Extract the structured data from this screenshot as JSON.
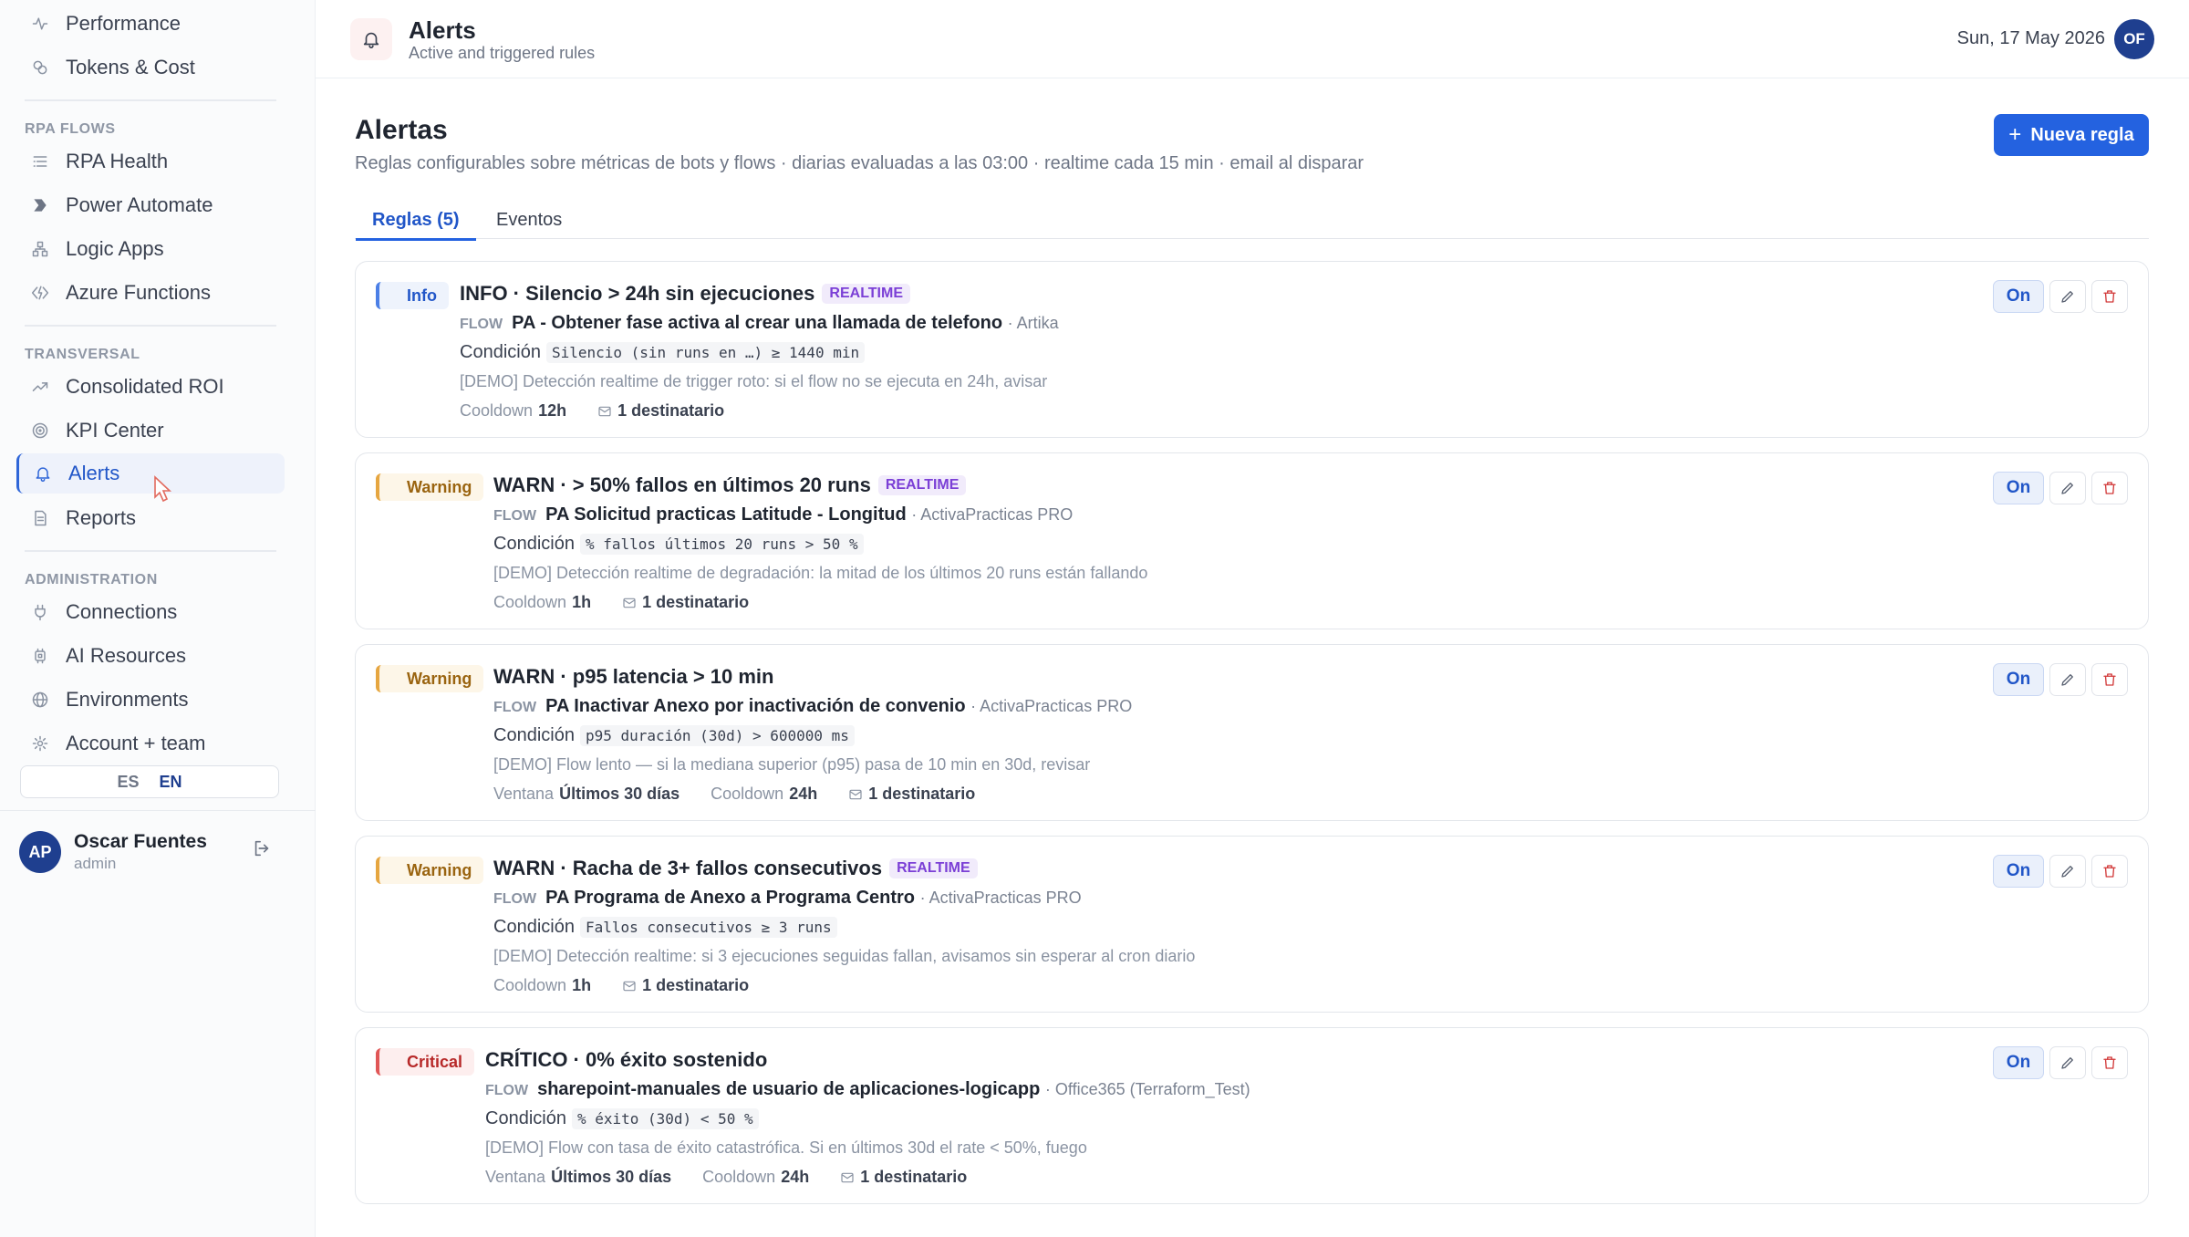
{
  "sidebar": {
    "items_top": [
      {
        "label": "Performance",
        "icon": "activity-icon"
      },
      {
        "label": "Tokens & Cost",
        "icon": "coins-icon"
      }
    ],
    "rpa_title": "RPA FLOWS",
    "rpa_items": [
      {
        "label": "RPA Health",
        "icon": "list-icon"
      },
      {
        "label": "Power Automate",
        "icon": "power-automate-icon"
      },
      {
        "label": "Logic Apps",
        "icon": "hierarchy-icon"
      },
      {
        "label": "Azure Functions",
        "icon": "functions-icon"
      }
    ],
    "transversal_title": "TRANSVERSAL",
    "transversal_items": [
      {
        "label": "Consolidated ROI",
        "icon": "trend-icon"
      },
      {
        "label": "KPI Center",
        "icon": "target-icon"
      },
      {
        "label": "Alerts",
        "icon": "bell-icon"
      },
      {
        "label": "Reports",
        "icon": "document-icon"
      }
    ],
    "admin_title": "ADMINISTRATION",
    "admin_items": [
      {
        "label": "Connections",
        "icon": "plug-icon"
      },
      {
        "label": "AI Resources",
        "icon": "chip-icon"
      },
      {
        "label": "Environments",
        "icon": "globe-icon"
      },
      {
        "label": "Account + team",
        "icon": "gear-icon"
      }
    ],
    "lang_es": "ES",
    "lang_en": "EN",
    "user": {
      "initials": "AP",
      "name": "Oscar Fuentes",
      "role": "admin"
    }
  },
  "header": {
    "title": "Alerts",
    "subtitle": "Active and triggered rules",
    "date": "Sun, 17 May 2026",
    "avatar": "OF"
  },
  "main": {
    "title": "Alertas",
    "description": "Reglas configurables sobre métricas de bots y flows · diarias evaluadas a las 03:00 · realtime cada 15 min · email al disparar",
    "new_button": "Nueva regla",
    "tabs": [
      "Reglas (5)",
      "Eventos"
    ]
  },
  "labels": {
    "flow": "FLOW",
    "condition": "Condición",
    "cooldown": "Cooldown",
    "window": "Ventana",
    "on": "On",
    "realtime": "REALTIME"
  },
  "rules": [
    {
      "severity": "Info",
      "name": "INFO · Silencio > 24h sin ejecuciones",
      "realtime": true,
      "flow": "PA - Obtener fase activa al crear una llamada de telefono",
      "env": "· Artika",
      "condition": "Silencio (sin runs en …) ≥ 1440 min",
      "description": "[DEMO] Detección realtime de trigger roto: si el flow no se ejecuta en 24h, avisar",
      "window": "",
      "cooldown": "12h",
      "recipients": "1 destinatario"
    },
    {
      "severity": "Warning",
      "name": "WARN · > 50% fallos en últimos 20 runs",
      "realtime": true,
      "flow": "PA Solicitud practicas Latitude - Longitud",
      "env": "· ActivaPracticas PRO",
      "condition": "% fallos últimos 20 runs > 50 %",
      "description": "[DEMO] Detección realtime de degradación: la mitad de los últimos 20 runs están fallando",
      "window": "",
      "cooldown": "1h",
      "recipients": "1 destinatario"
    },
    {
      "severity": "Warning",
      "name": "WARN · p95 latencia > 10 min",
      "realtime": false,
      "flow": "PA Inactivar Anexo por inactivación de convenio",
      "env": "· ActivaPracticas PRO",
      "condition": "p95 duración (30d) > 600000 ms",
      "description": "[DEMO] Flow lento — si la mediana superior (p95) pasa de 10 min en 30d, revisar",
      "window": "Últimos 30 días",
      "cooldown": "24h",
      "recipients": "1 destinatario"
    },
    {
      "severity": "Warning",
      "name": "WARN · Racha de 3+ fallos consecutivos",
      "realtime": true,
      "flow": "PA Programa de Anexo a Programa Centro",
      "env": "· ActivaPracticas PRO",
      "condition": "Fallos consecutivos ≥ 3 runs",
      "description": "[DEMO] Detección realtime: si 3 ejecuciones seguidas fallan, avisamos sin esperar al cron diario",
      "window": "",
      "cooldown": "1h",
      "recipients": "1 destinatario"
    },
    {
      "severity": "Critical",
      "name": "CRÍTICO · 0% éxito sostenido",
      "realtime": false,
      "flow": "sharepoint-manuales de usuario de aplicaciones-logicapp",
      "env": "· Office365 (Terraform_Test)",
      "condition": "% éxito (30d) < 50 %",
      "description": "[DEMO] Flow con tasa de éxito catastrófica. Si en últimos 30d el rate < 50%, fuego",
      "window": "Últimos 30 días",
      "cooldown": "24h",
      "recipients": "1 destinatario"
    }
  ]
}
